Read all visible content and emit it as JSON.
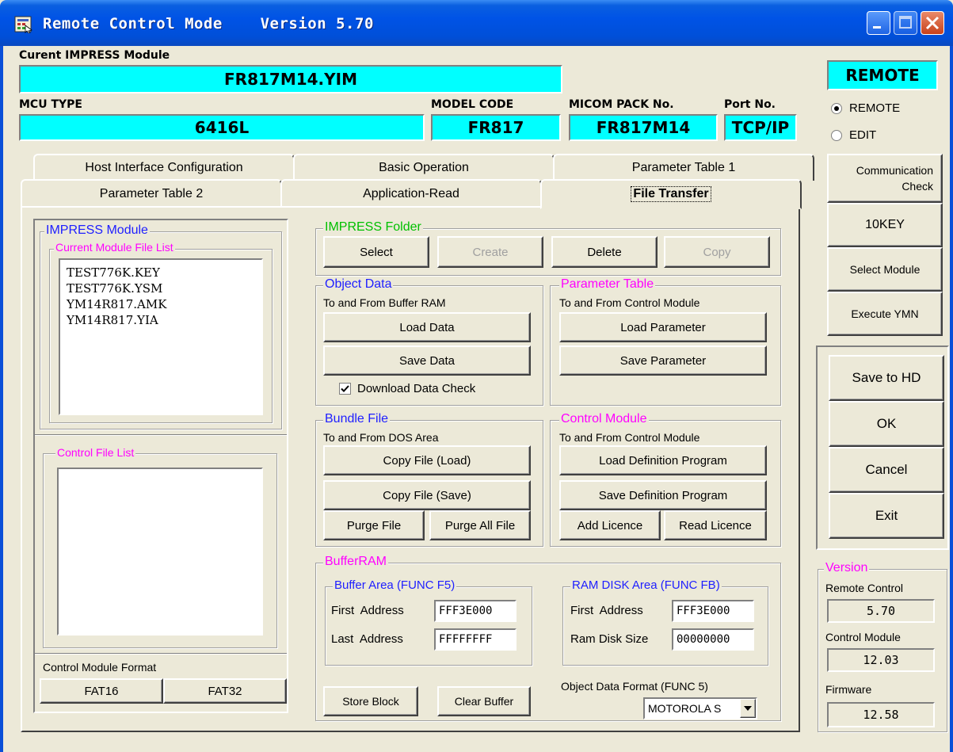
{
  "window": {
    "title": "Remote Control Mode",
    "version_label": "Version 5.70"
  },
  "header": {
    "module_label": "Curent IMPRESS Module",
    "module_value": "FR817M14.YIM",
    "mcu_label": "MCU TYPE",
    "mcu_value": "6416L",
    "model_label": "MODEL CODE",
    "model_value": "FR817",
    "micom_label": "MICOM PACK No.",
    "micom_value": "FR817M14",
    "port_label": "Port No.",
    "port_value": "TCP/IP",
    "status": "REMOTE"
  },
  "mode": {
    "options": [
      "REMOTE",
      "EDIT"
    ],
    "selected": "REMOTE"
  },
  "tabs": {
    "row1": [
      "Host Interface Configuration",
      "Basic Operation",
      "Parameter Table 1"
    ],
    "row2": [
      "Parameter Table 2",
      "Application-Read",
      "File Transfer"
    ],
    "active": "File Transfer"
  },
  "impress_module": {
    "title": "IMPRESS Module",
    "current_list_title": "Current Module File List",
    "files": [
      "TEST776K.KEY",
      "TEST776K.YSM",
      "YM14R817.AMK",
      "YM14R817.YIA"
    ],
    "control_list_title": "Control File List",
    "format_label": "Control Module Format",
    "format_buttons": [
      "FAT16",
      "FAT32"
    ]
  },
  "impress_folder": {
    "title": "IMPRESS Folder",
    "buttons": [
      "Select",
      "Create",
      "Delete",
      "Copy"
    ],
    "disabled": [
      false,
      true,
      false,
      true
    ]
  },
  "object_data": {
    "title": "Object Data",
    "subtitle": "To and From Buffer RAM",
    "load": "Load Data",
    "save": "Save Data",
    "check_label": "Download Data Check",
    "checked": true
  },
  "parameter_table": {
    "title": "Parameter Table",
    "subtitle": "To and From Control Module",
    "load": "Load Parameter",
    "save": "Save Parameter"
  },
  "bundle_file": {
    "title": "Bundle File",
    "subtitle": "To and From DOS Area",
    "copy_load": "Copy File (Load)",
    "copy_save": "Copy File (Save)",
    "purge": "Purge File",
    "purge_all": "Purge All File"
  },
  "control_module": {
    "title": "Control Module",
    "subtitle": "To and From Control Module",
    "load_def": "Load Definition Program",
    "save_def": "Save Definition Program",
    "add_licence": "Add Licence",
    "read_licence": "Read Licence"
  },
  "buffer_ram": {
    "title": "BufferRAM",
    "buffer_area_title": "Buffer Area (FUNC F5)",
    "first_address_label": "First  Address",
    "first_address": "FFF3E000",
    "last_address_label": "Last  Address",
    "last_address": "FFFFFFFF",
    "ram_disk_title": "RAM DISK Area (FUNC FB)",
    "ram_first_label": "First  Address",
    "ram_first": "FFF3E000",
    "ram_size_label": "Ram Disk Size",
    "ram_size": "00000000",
    "store_block": "Store Block",
    "clear_buffer": "Clear Buffer",
    "format_label": "Object Data Format (FUNC 5)",
    "format_value": "MOTOROLA S"
  },
  "side": {
    "comm_check": "Communication\nCheck",
    "tenkey": "10KEY",
    "select_module": "Select Module",
    "execute_ymn": "Execute YMN",
    "save_hd": "Save to HD",
    "ok": "OK",
    "cancel": "Cancel",
    "exit": "Exit"
  },
  "version": {
    "title": "Version",
    "remote_label": "Remote Control",
    "remote_value": "5.70",
    "control_label": "Control Module",
    "control_value": "12.03",
    "firmware_label": "Firmware",
    "firmware_value": "12.58"
  }
}
